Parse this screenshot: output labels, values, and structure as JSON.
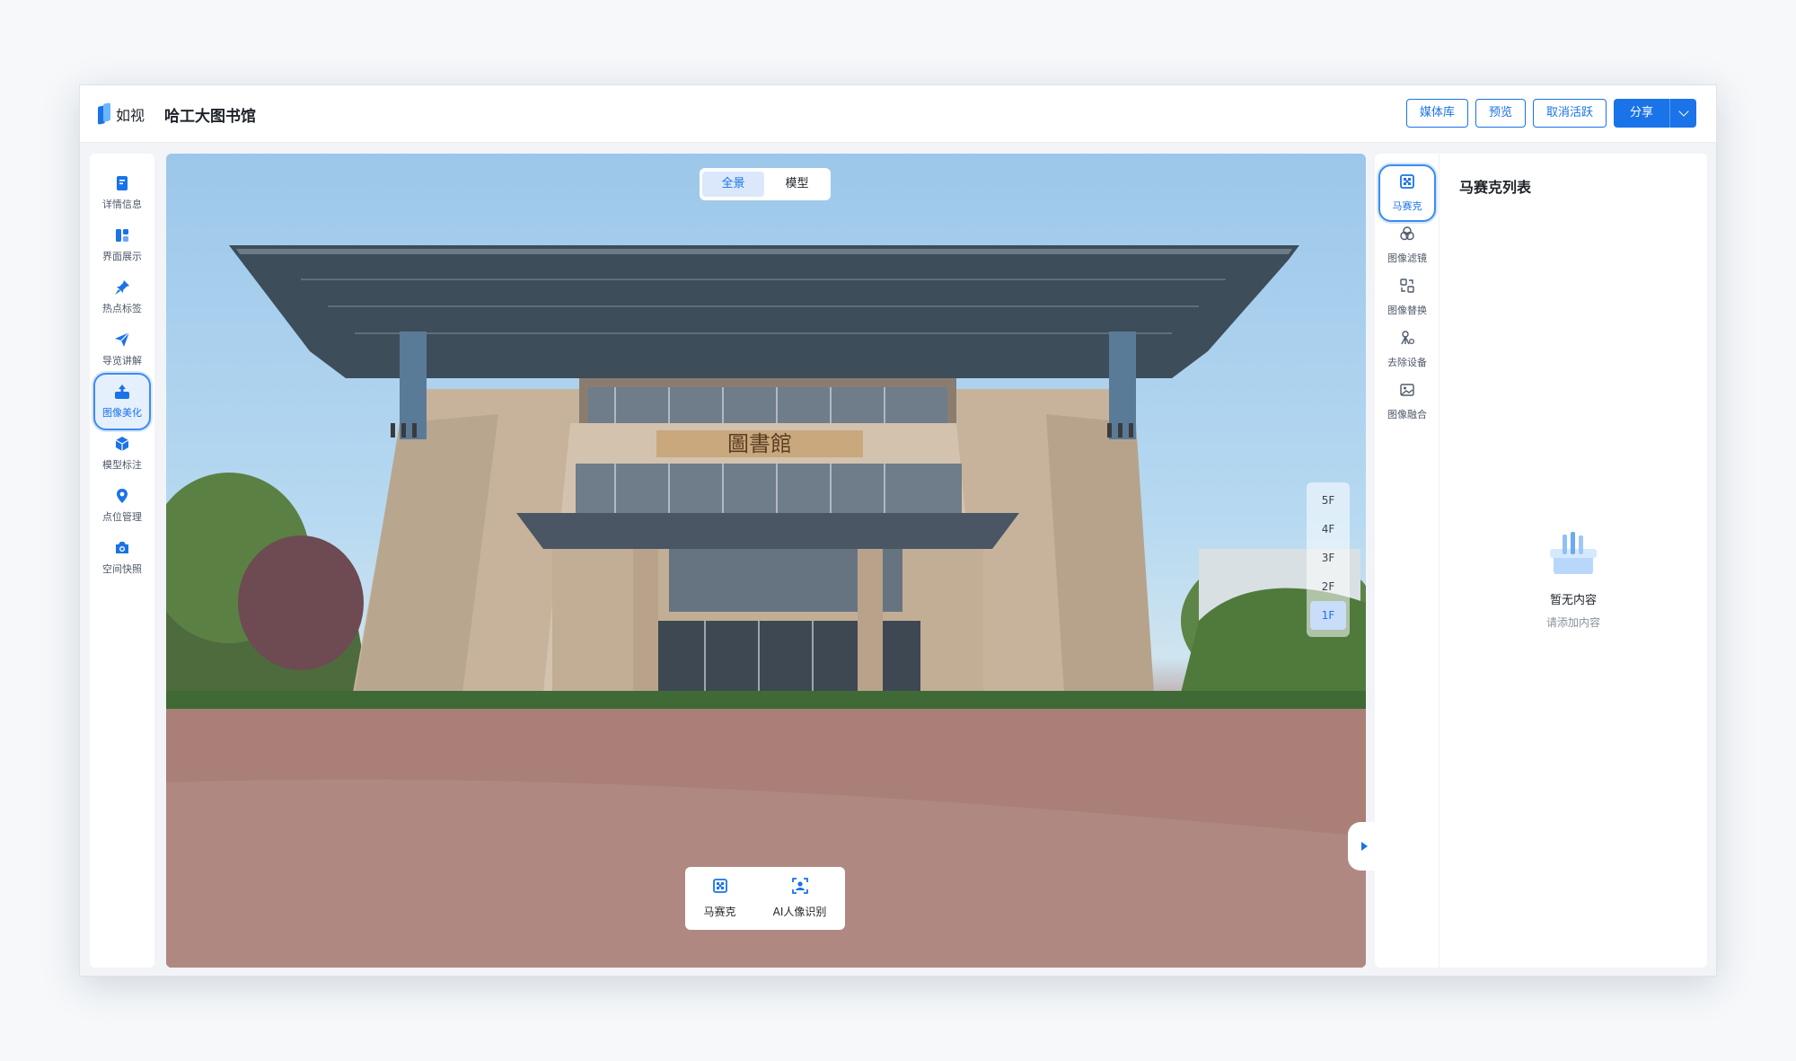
{
  "app": {
    "logo_text": "如视",
    "project_title": "哈工大图书馆"
  },
  "header": {
    "buttons": [
      "媒体库",
      "预览",
      "取消活跃"
    ],
    "share_label": "分享"
  },
  "left_nav": {
    "items": [
      {
        "label": "详情信息",
        "icon": "document-icon"
      },
      {
        "label": "界面展示",
        "icon": "layout-icon"
      },
      {
        "label": "热点标签",
        "icon": "pin-icon"
      },
      {
        "label": "导览讲解",
        "icon": "paper-plane-icon"
      },
      {
        "label": "图像美化",
        "icon": "image-upload-icon",
        "active": true
      },
      {
        "label": "模型标注",
        "icon": "cube-icon"
      },
      {
        "label": "点位管理",
        "icon": "location-icon"
      },
      {
        "label": "空间快照",
        "icon": "camera-icon"
      }
    ]
  },
  "viewer": {
    "view_modes": [
      "全景",
      "模型"
    ],
    "active_view": "全景",
    "floors": [
      "5F",
      "4F",
      "3F",
      "2F",
      "1F"
    ],
    "active_floor": "1F",
    "sign_text": "圖書館",
    "tools": [
      {
        "label": "马赛克",
        "icon": "mosaic-icon"
      },
      {
        "label": "AI人像识别",
        "icon": "face-scan-icon"
      }
    ]
  },
  "right_panel": {
    "sub_nav": [
      {
        "label": "马赛克",
        "icon": "mosaic-icon",
        "active": true
      },
      {
        "label": "图像滤镜",
        "icon": "filter-icon"
      },
      {
        "label": "图像替换",
        "icon": "replace-icon"
      },
      {
        "label": "去除设备",
        "icon": "tripod-remove-icon"
      },
      {
        "label": "图像融合",
        "icon": "merge-icon"
      }
    ],
    "list_title": "马赛克列表",
    "empty_title": "暂无内容",
    "empty_hint": "请添加内容"
  },
  "colors": {
    "accent": "#1a73e8",
    "active_bg": "#e6f0fd"
  }
}
